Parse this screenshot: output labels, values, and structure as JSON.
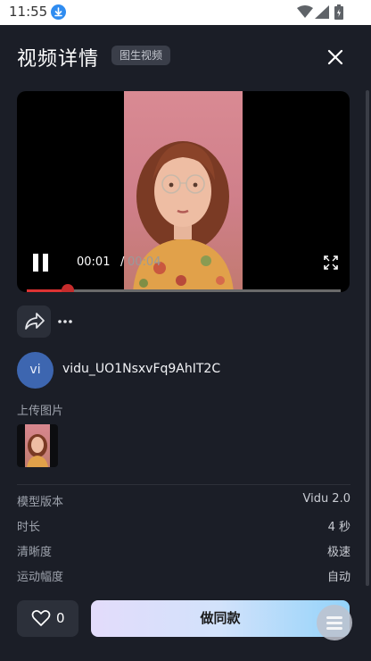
{
  "status_bar": {
    "time": "11:55",
    "icons": [
      "download-icon",
      "wifi-icon",
      "signal-icon",
      "battery-icon"
    ]
  },
  "header": {
    "title": "视频详情",
    "badge": "图生视频",
    "close_icon": "close-icon"
  },
  "player": {
    "current_time": "00:01",
    "separator": "/",
    "total_time": "00:04",
    "progress": 0.13,
    "icons": [
      "pause-icon",
      "fullscreen-icon"
    ]
  },
  "actions": {
    "icons": [
      "share-icon",
      "more-icon"
    ]
  },
  "author": {
    "avatar_text": "vi",
    "name": "vidu_UO1NsxvFq9AhIT2C"
  },
  "upload": {
    "label": "上传图片"
  },
  "details": [
    {
      "key": "模型版本",
      "value": "Vidu 2.0"
    },
    {
      "key": "时长",
      "value": "4 秒"
    },
    {
      "key": "清晰度",
      "value": "极速"
    },
    {
      "key": "运动幅度",
      "value": "自动"
    }
  ],
  "footer": {
    "like_count": "0",
    "same_style_label": "做同款",
    "icons": [
      "heart-icon",
      "menu-icon"
    ]
  },
  "colors": {
    "background": "#1b1e27",
    "accent_gradient": [
      "#e3dcfb",
      "#93d3fa"
    ],
    "progress": "#c62c2c"
  }
}
